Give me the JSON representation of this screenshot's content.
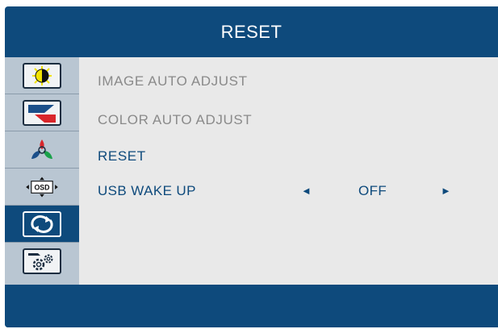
{
  "menu": {
    "title": "RESET",
    "tabs": [
      {
        "id": "brightness",
        "icon": "brightness-contrast-icon",
        "active": false
      },
      {
        "id": "image",
        "icon": "image-settings-icon",
        "active": false
      },
      {
        "id": "color",
        "icon": "color-rgb-icon",
        "active": false
      },
      {
        "id": "osd",
        "icon": "osd-position-icon",
        "label": "OSD",
        "active": false
      },
      {
        "id": "reset",
        "icon": "reset-cycle-icon",
        "active": true
      },
      {
        "id": "setup",
        "icon": "gear-settings-icon",
        "active": false
      }
    ],
    "items": [
      {
        "label": "IMAGE  AUTO  ADJUST",
        "enabled": false
      },
      {
        "label": "COLOR  AUTO  ADJUST",
        "enabled": false
      },
      {
        "label": "RESET",
        "enabled": true
      },
      {
        "label": "USB WAKE UP",
        "enabled": true
      }
    ],
    "usb_wake_up": {
      "value": "OFF",
      "left_arrow": "◄",
      "right_arrow": "►"
    }
  },
  "colors": {
    "frame": "#0e4a7c",
    "content_bg": "#e9e9e9",
    "sidebar_bg": "#b9c6d2",
    "disabled_text": "#8a8a8a",
    "enabled_text": "#0e4a7c"
  }
}
